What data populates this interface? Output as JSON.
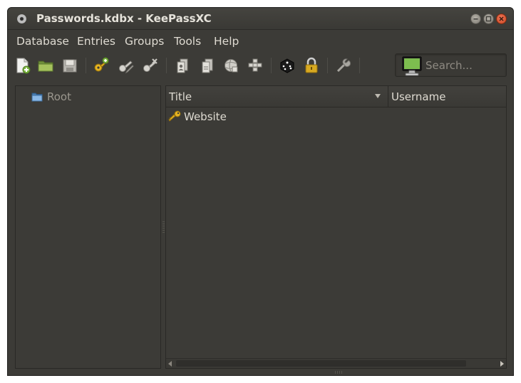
{
  "window": {
    "title": "Passwords.kdbx - KeePassXC"
  },
  "menubar": {
    "items": [
      {
        "label": "Database"
      },
      {
        "label": "Entries"
      },
      {
        "label": "Groups"
      },
      {
        "label": "Tools"
      },
      {
        "label": "Help"
      }
    ]
  },
  "toolbar": {
    "buttons": [
      {
        "icon": "new-database-icon"
      },
      {
        "icon": "open-database-icon"
      },
      {
        "icon": "save-database-icon"
      },
      {
        "icon": "add-entry-icon"
      },
      {
        "icon": "edit-entry-icon"
      },
      {
        "icon": "delete-entry-icon"
      },
      {
        "icon": "copy-username-icon"
      },
      {
        "icon": "copy-password-icon"
      },
      {
        "icon": "copy-url-icon"
      },
      {
        "icon": "autotype-icon"
      },
      {
        "icon": "password-generator-icon"
      },
      {
        "icon": "lock-database-icon"
      },
      {
        "icon": "settings-icon"
      }
    ],
    "search": {
      "placeholder": "Search...",
      "value": ""
    }
  },
  "groups": {
    "items": [
      {
        "label": "Root",
        "icon": "folder-icon"
      }
    ]
  },
  "entries": {
    "columns": [
      {
        "label": "Title"
      },
      {
        "label": "Username"
      }
    ],
    "rows": [
      {
        "title": "Website",
        "username": "",
        "icon": "key-icon"
      }
    ]
  },
  "colors": {
    "window_bg": "#3c3b37",
    "text": "#dfdbd2",
    "muted_text": "#9b978e",
    "close_button": "#e05b36",
    "lock_gold": "#d7a921",
    "add_green": "#7cb342"
  }
}
